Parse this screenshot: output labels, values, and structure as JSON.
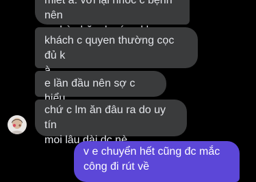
{
  "messages": [
    {
      "from": "other",
      "text": "miết á. với lại nhóc c bệnh nên\no nhà chăm k có ra kho."
    },
    {
      "from": "other",
      "text": "khách c quyen thường cọc đủ k\nà"
    },
    {
      "from": "other",
      "text": "e lần đầu nên sợ c hiểu"
    },
    {
      "from": "other",
      "text": "chứ c lm ăn đâu ra do uy tín\nmoi lâu dài dc nè"
    },
    {
      "from": "me",
      "text": "v e chuyển hết cũng đc mắc\ncông đi rút về"
    }
  ],
  "colors": {
    "background": "#000000",
    "incoming_bubble": "#3a3b3c",
    "outgoing_bubble": "#5c47d8",
    "incoming_text": "#e4e6eb",
    "outgoing_text": "#ffffff"
  },
  "icons": {
    "contact_avatar": "avatar-icon"
  }
}
